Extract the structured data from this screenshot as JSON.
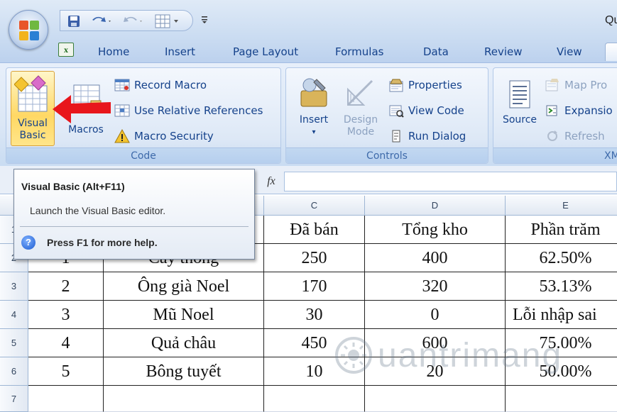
{
  "window": {
    "title_fragment": "Qu"
  },
  "qat": {
    "save": "save-icon",
    "undo": "undo-icon",
    "redo": "redo-icon",
    "view": "grid-icon",
    "customize": "₹"
  },
  "tabs": [
    "Home",
    "Insert",
    "Page Layout",
    "Formulas",
    "Data",
    "Review",
    "View"
  ],
  "ribbon": {
    "code": {
      "label": "Code",
      "visual_basic": [
        "Visual",
        "Basic"
      ],
      "macros": "Macros",
      "record_macro": "Record Macro",
      "use_relative": "Use Relative References",
      "macro_security": "Macro Security"
    },
    "controls": {
      "label": "Controls",
      "insert": "Insert",
      "design_mode": [
        "Design",
        "Mode"
      ],
      "properties": "Properties",
      "view_code": "View Code",
      "run_dialog": "Run Dialog"
    },
    "xml": {
      "label": "XM",
      "source": "Source",
      "map_properties": "Map Pro",
      "expansion": "Expansio",
      "refresh": "Refresh"
    }
  },
  "formula_bar": {
    "fx": "fx"
  },
  "grid": {
    "columns": [
      "C",
      "D",
      "E"
    ],
    "rows": [
      "2",
      "3",
      "4",
      "5",
      "6",
      "7"
    ],
    "header_row": {
      "col_c": "Đã bán",
      "col_d": "Tổng kho",
      "col_e": "Phần trăm"
    },
    "data": [
      {
        "a": "1",
        "b": "Cây thông",
        "c": "250",
        "d": "400",
        "e": "62.50%"
      },
      {
        "a": "2",
        "b": "Ông già Noel",
        "c": "170",
        "d": "320",
        "e": "53.13%"
      },
      {
        "a": "3",
        "b": "Mũ Noel",
        "c": "30",
        "d": "0",
        "e": "Lỗi nhập sai"
      },
      {
        "a": "4",
        "b": "Quả châu",
        "c": "450",
        "d": "600",
        "e": "75.00%"
      },
      {
        "a": "5",
        "b": "Bông tuyết",
        "c": "10",
        "d": "20",
        "e": "50.00%"
      }
    ]
  },
  "tooltip": {
    "title": "Visual Basic (Alt+F11)",
    "description": "Launch the Visual Basic editor.",
    "help": "Press F1 for more help.",
    "help_icon": "?"
  },
  "watermark": {
    "text": "uantrimang"
  },
  "colors": {
    "arrow": "#e8161c",
    "ribbon_text": "#15428b",
    "hover_button": "#ffd864"
  }
}
